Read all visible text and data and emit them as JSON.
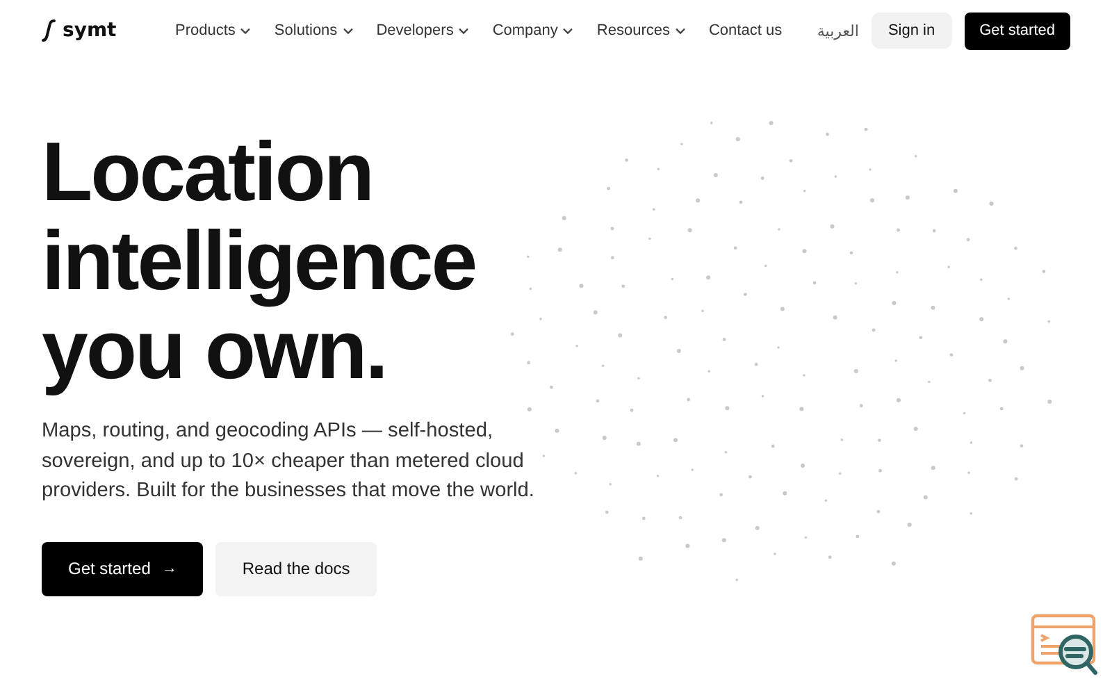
{
  "header": {
    "logo": "symt",
    "nav": [
      {
        "label": "Products",
        "has_menu": true
      },
      {
        "label": "Solutions",
        "has_menu": true
      },
      {
        "label": "Developers",
        "has_menu": true
      },
      {
        "label": "Company",
        "has_menu": true
      },
      {
        "label": "Resources",
        "has_menu": true
      },
      {
        "label": "Contact us",
        "has_menu": false
      }
    ],
    "language": "العربية",
    "sign_in": "Sign in",
    "get_started": "Get started"
  },
  "hero": {
    "headline": [
      "Location",
      "intelligence",
      "you own."
    ],
    "subtitle": "Maps, routing, and geocoding APIs — self-hosted, sovereign, and up to 10× cheaper than metered cloud providers. Built for the businesses that move the world.",
    "primary_button": {
      "label": "Get started",
      "icon": "→"
    },
    "secondary_button": "Read the docs"
  }
}
